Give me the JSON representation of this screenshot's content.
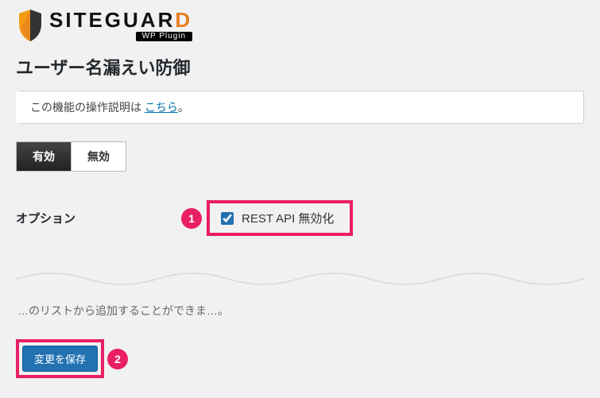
{
  "logo": {
    "title_main": "SITEGUAR",
    "title_accent": "D",
    "subtitle": "WP Plugin"
  },
  "page": {
    "title": "ユーザー名漏えい防御"
  },
  "notice": {
    "prefix": "この機能の操作説明は ",
    "link_text": "こちら",
    "suffix": "。"
  },
  "toggle": {
    "on_label": "有効",
    "off_label": "無効"
  },
  "options": {
    "section_label": "オプション",
    "rest_api_disable_label": "REST API 無効化",
    "rest_api_disable_checked": true
  },
  "truncated": {
    "text": "…のリストから追加することができま…。"
  },
  "callouts": {
    "one": "1",
    "two": "2"
  },
  "buttons": {
    "save_label": "変更を保存"
  }
}
